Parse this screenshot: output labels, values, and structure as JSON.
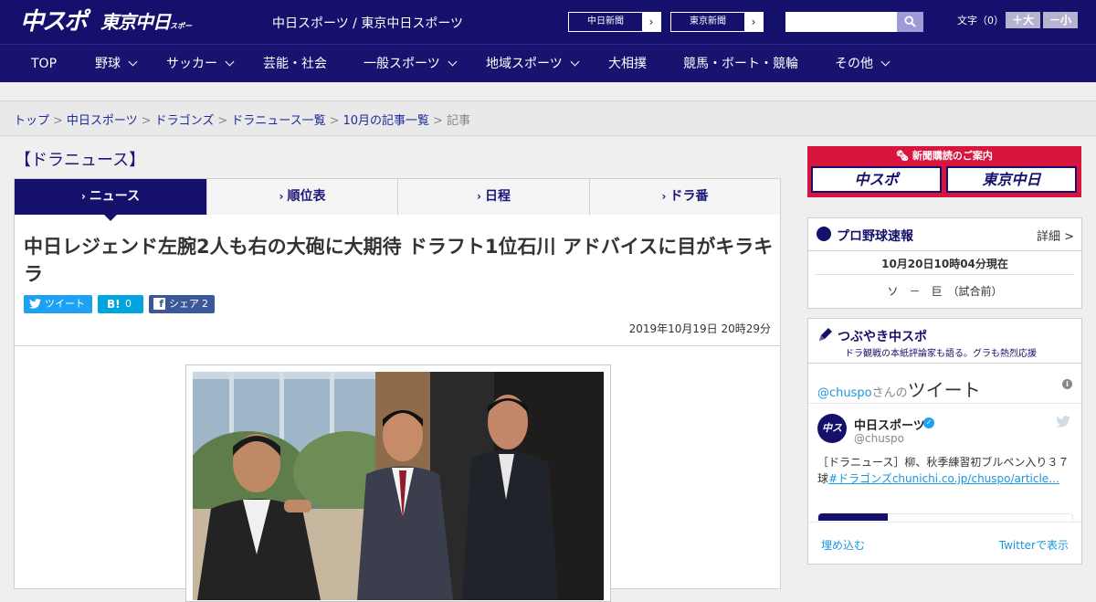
{
  "header": {
    "logo_main": "中スポ",
    "logo_tokyo": "東京中日",
    "logo_tokyo_small": "スポーツ",
    "site_title": "中日スポーツ / 東京中日スポーツ",
    "links": [
      {
        "label": "中日新聞"
      },
      {
        "label": "東京新聞"
      }
    ],
    "search_placeholder": "",
    "fontsize_label": "文字（0）",
    "fontsize_up": "＋大",
    "fontsize_down": "－小"
  },
  "nav": {
    "items": [
      {
        "label": "TOP",
        "has_menu": false
      },
      {
        "label": "野球",
        "has_menu": true
      },
      {
        "label": "サッカー",
        "has_menu": true
      },
      {
        "label": "芸能・社会",
        "has_menu": false
      },
      {
        "label": "一般スポーツ",
        "has_menu": true
      },
      {
        "label": "地域スポーツ",
        "has_menu": true
      },
      {
        "label": "大相撲",
        "has_menu": false
      },
      {
        "label": "競馬・ボート・競輪",
        "has_menu": false
      },
      {
        "label": "その他",
        "has_menu": true
      }
    ]
  },
  "breadcrumb": {
    "links": [
      "トップ",
      "中日スポーツ",
      "ドラゴンズ",
      "ドラニュース一覧",
      "10月の記事一覧"
    ],
    "current": "記事",
    "separator": ">"
  },
  "section_title": "【ドラニュース】",
  "tabs": [
    {
      "label": "ニュース",
      "active": true
    },
    {
      "label": "順位表",
      "active": false
    },
    {
      "label": "日程",
      "active": false
    },
    {
      "label": "ドラ番",
      "active": false
    }
  ],
  "article": {
    "headline": "中日レジェンド左腕2人も右の大砲に大期待 ドラフト1位石川 アドバイスに目がキラキラ",
    "share": {
      "tweet_label": "ツイート",
      "hatena_label": "B!",
      "hatena_count": "0",
      "facebook_label": "シェア",
      "facebook_count": "2"
    },
    "date": "2019年10月19日 20時29分"
  },
  "sidebar": {
    "subscribe_caption": "新聞購読のご案内",
    "subscribe_left": "中スポ",
    "subscribe_right": "東京中日",
    "baseball": {
      "title": "プロ野球速報",
      "more": "詳細 >",
      "time": "10月20日10時04分現在",
      "score": "ソ　－　巨　（試合前）"
    },
    "twitter": {
      "title": "つぶやき中スポ",
      "subtitle": "ドラ観戦の本紙評論家も語る。グラも熱烈応援",
      "handle_prefix": "@chuspo",
      "handle_suffix": "さんの",
      "heading_word": "ツイート",
      "account_name": "中日スポーツ",
      "account_handle": "@chuspo",
      "tweet_text": "［ドラニュース］柳、秋季練習初ブルペン入り３７球",
      "tweet_link": "#ドラゴンズchunichi.co.jp/chuspo/article…",
      "embed_label": "埋め込む",
      "view_label": "Twitterで表示"
    }
  },
  "colors": {
    "navy": "#14106b",
    "accent_red": "#d8163d",
    "twitter_blue": "#1b95e0"
  }
}
